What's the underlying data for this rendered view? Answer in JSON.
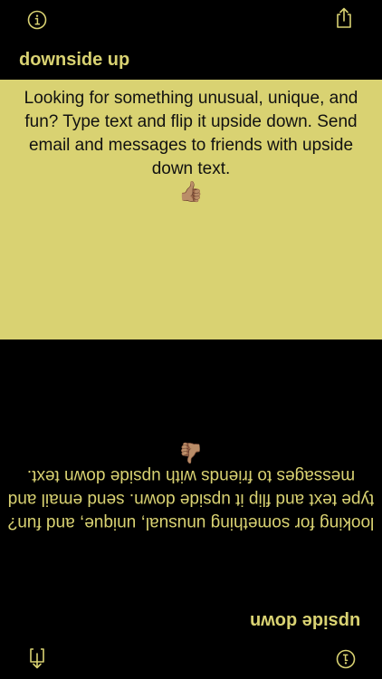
{
  "header": {
    "title": "downside up",
    "info_icon": "info-circle-icon",
    "share_icon": "share-icon"
  },
  "top_panel": {
    "text": "Looking for something unusual, unique, and fun? Type text and flip it upside down. Send email and messages to friends with upside down text.",
    "emoji": "👍🏽"
  },
  "bottom_panel": {
    "flipped_text": "looking for something unusual, unique, and fun? type text and flip it upside down. send email and messages to friends with upside down text.",
    "emoji": "👍🏽"
  },
  "footer": {
    "title": "upside down",
    "download_icon": "download-icon",
    "info_icon": "info-circle-icon"
  },
  "colors": {
    "accent": "#D9D272",
    "background": "#000000",
    "text_dark": "#111111"
  }
}
